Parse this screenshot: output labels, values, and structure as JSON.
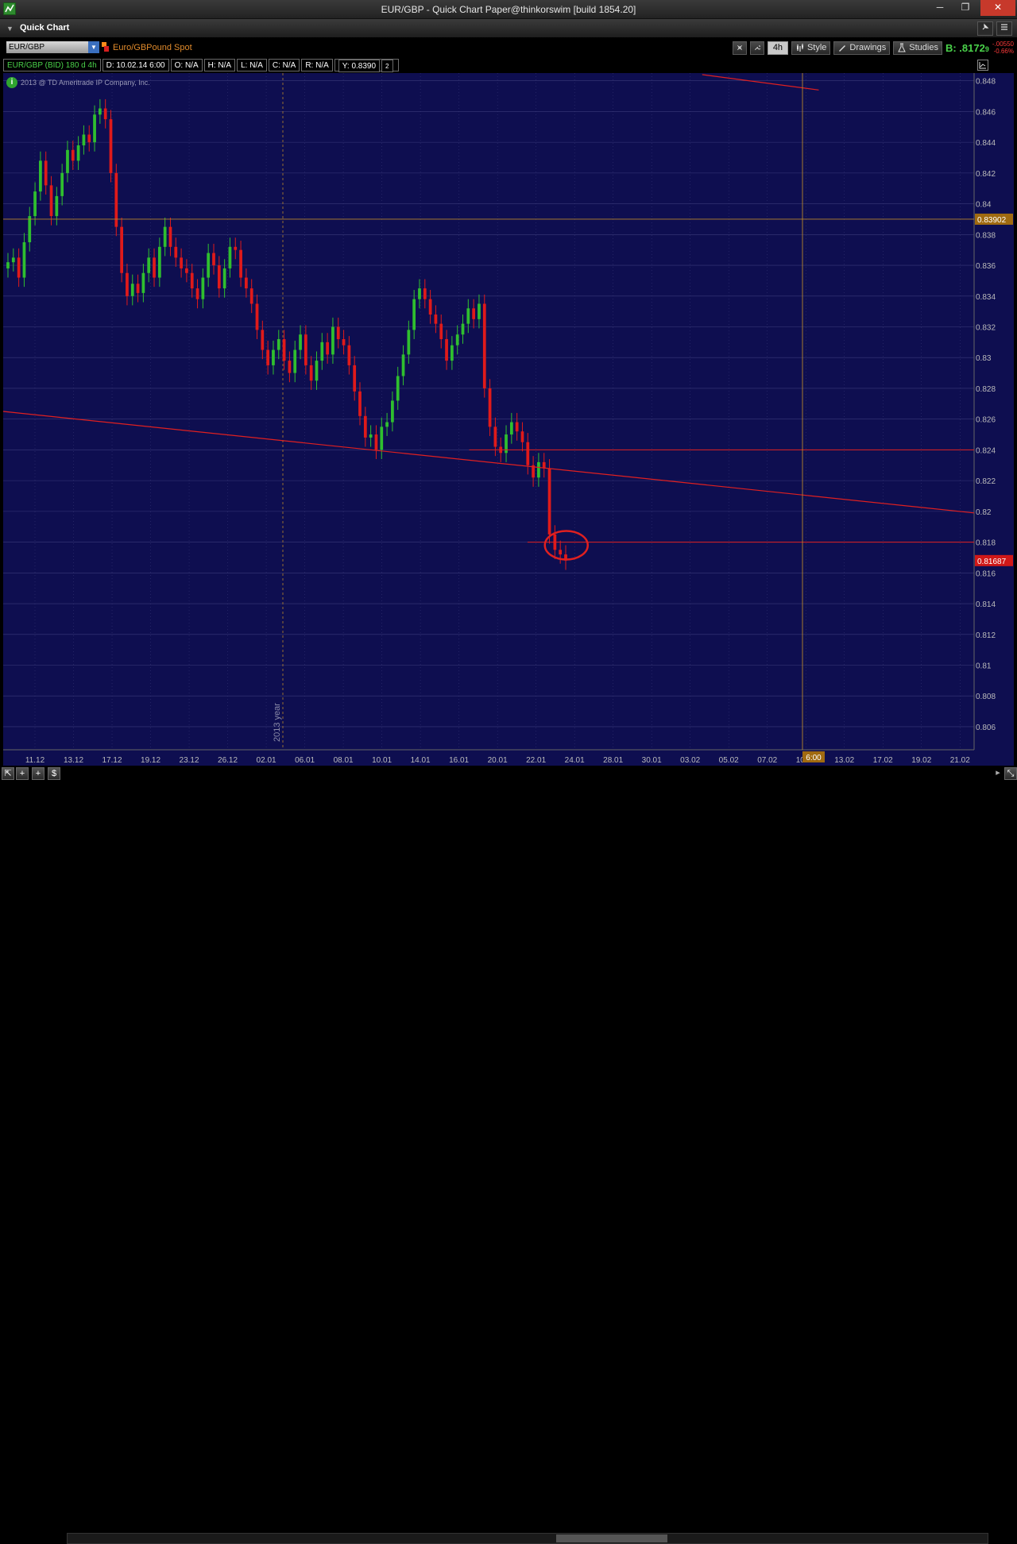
{
  "window": {
    "title": "EUR/GBP - Quick Chart Paper@thinkorswim [build 1854.20]",
    "minimize": "─",
    "maximize": "❐",
    "close": "✕"
  },
  "panel": {
    "title": "Quick Chart",
    "pin_icon": "pin-icon",
    "menu_icon": "menu-icon"
  },
  "toolbar": {
    "symbol": "EUR/GBP",
    "description": "Euro/GBPound Spot",
    "aggregation": "4h",
    "style_label": "Style",
    "drawings_label": "Drawings",
    "studies_label": "Studies",
    "bid_label": "B: .8172",
    "bid_suffix": "9",
    "change_abs": "-.00550",
    "change_pct": "-0.66%"
  },
  "infobar": {
    "instrument": "EUR/GBP (BID) 180 d 4h",
    "date": "D: 10.02.14 6:00",
    "open": "O: N/A",
    "high": "H: N/A",
    "low": "L: N/A",
    "close": "C: N/A",
    "range": "R: N/A",
    "y": "Y: 0.8390",
    "y_suffix": "2"
  },
  "copyright": "2013 @ TD Ameritrade IP Company, Inc.",
  "colors": {
    "background": "#0e0e50",
    "up": "#2fbf2f",
    "down": "#e01a1a",
    "drawing": "#e02020",
    "crosshair": "#b8862b",
    "grid": "#3a3a7a"
  },
  "chart_data": {
    "type": "candlestick",
    "instrument": "EUR/GBP",
    "ylim": [
      0.8045,
      0.8485
    ],
    "y_ticks": [
      0.848,
      0.846,
      0.844,
      0.842,
      0.84,
      0.838,
      0.836,
      0.834,
      0.832,
      0.83,
      0.828,
      0.826,
      0.824,
      0.822,
      0.82,
      0.818,
      0.816,
      0.814,
      0.812,
      0.81,
      0.808,
      0.806
    ],
    "y_tick_labels": [
      "0.848",
      "0.846",
      "0.844",
      "0.842",
      "0.84",
      "0.838",
      "0.836",
      "0.834",
      "0.832",
      "0.83",
      "0.828",
      "0.826",
      "0.824",
      "0.822",
      "0.82",
      "0.818",
      "0.816",
      "0.814",
      "0.812",
      "0.81",
      "0.808",
      "0.806"
    ],
    "x_tick_labels": [
      "11.12",
      "13.12",
      "17.12",
      "19.12",
      "23.12",
      "26.12",
      "02.01",
      "06.01",
      "08.01",
      "10.01",
      "14.01",
      "16.01",
      "20.01",
      "22.01",
      "24.01",
      "28.01",
      "30.01",
      "03.02",
      "05.02",
      "07.02",
      "10.02",
      "13.02",
      "17.02",
      "19.02",
      "21.02"
    ],
    "year_marker": "2013 year",
    "crosshair_price": "0.8390",
    "crosshair_price_suffix": "2",
    "crosshair_time": "6:00",
    "last_price": "0.8168",
    "last_price_suffix": "7",
    "closes": [
      0.8362,
      0.8365,
      0.8352,
      0.8375,
      0.8392,
      0.8408,
      0.8428,
      0.8412,
      0.8392,
      0.8405,
      0.842,
      0.8435,
      0.8428,
      0.8438,
      0.8445,
      0.844,
      0.8458,
      0.8462,
      0.8455,
      0.842,
      0.8385,
      0.8355,
      0.834,
      0.8348,
      0.8342,
      0.8355,
      0.8365,
      0.8352,
      0.8372,
      0.8385,
      0.8372,
      0.8365,
      0.8358,
      0.8355,
      0.8345,
      0.8338,
      0.8352,
      0.8368,
      0.836,
      0.8345,
      0.8358,
      0.8372,
      0.837,
      0.8352,
      0.8345,
      0.8335,
      0.8318,
      0.8305,
      0.8295,
      0.8305,
      0.8312,
      0.8298,
      0.829,
      0.8305,
      0.8315,
      0.8295,
      0.8285,
      0.8298,
      0.831,
      0.8302,
      0.832,
      0.8312,
      0.8308,
      0.8295,
      0.8278,
      0.8262,
      0.8248,
      0.825,
      0.824,
      0.8255,
      0.8258,
      0.8272,
      0.8288,
      0.8302,
      0.8318,
      0.8338,
      0.8345,
      0.8338,
      0.8328,
      0.8322,
      0.8312,
      0.8298,
      0.8308,
      0.8315,
      0.8322,
      0.8332,
      0.8325,
      0.8335,
      0.828,
      0.8255,
      0.8242,
      0.8238,
      0.825,
      0.8258,
      0.8252,
      0.8245,
      0.823,
      0.8222,
      0.8232,
      0.8228,
      0.8185,
      0.8175,
      0.8172,
      0.8168
    ],
    "drawings": [
      {
        "kind": "trendline",
        "from": {
          "x": 0,
          "y": 0.8265
        },
        "to": {
          "x": 1,
          "y": 0.8199
        }
      },
      {
        "kind": "trendline",
        "from": {
          "x": 0.72,
          "y": 0.8484
        },
        "to": {
          "x": 0.84,
          "y": 0.8474
        }
      },
      {
        "kind": "horizontal",
        "y": 0.824,
        "from_x": 0.48
      },
      {
        "kind": "horizontal",
        "y": 0.818,
        "from_x": 0.54
      },
      {
        "kind": "circle",
        "x": 0.58,
        "y": 0.8178
      }
    ]
  }
}
